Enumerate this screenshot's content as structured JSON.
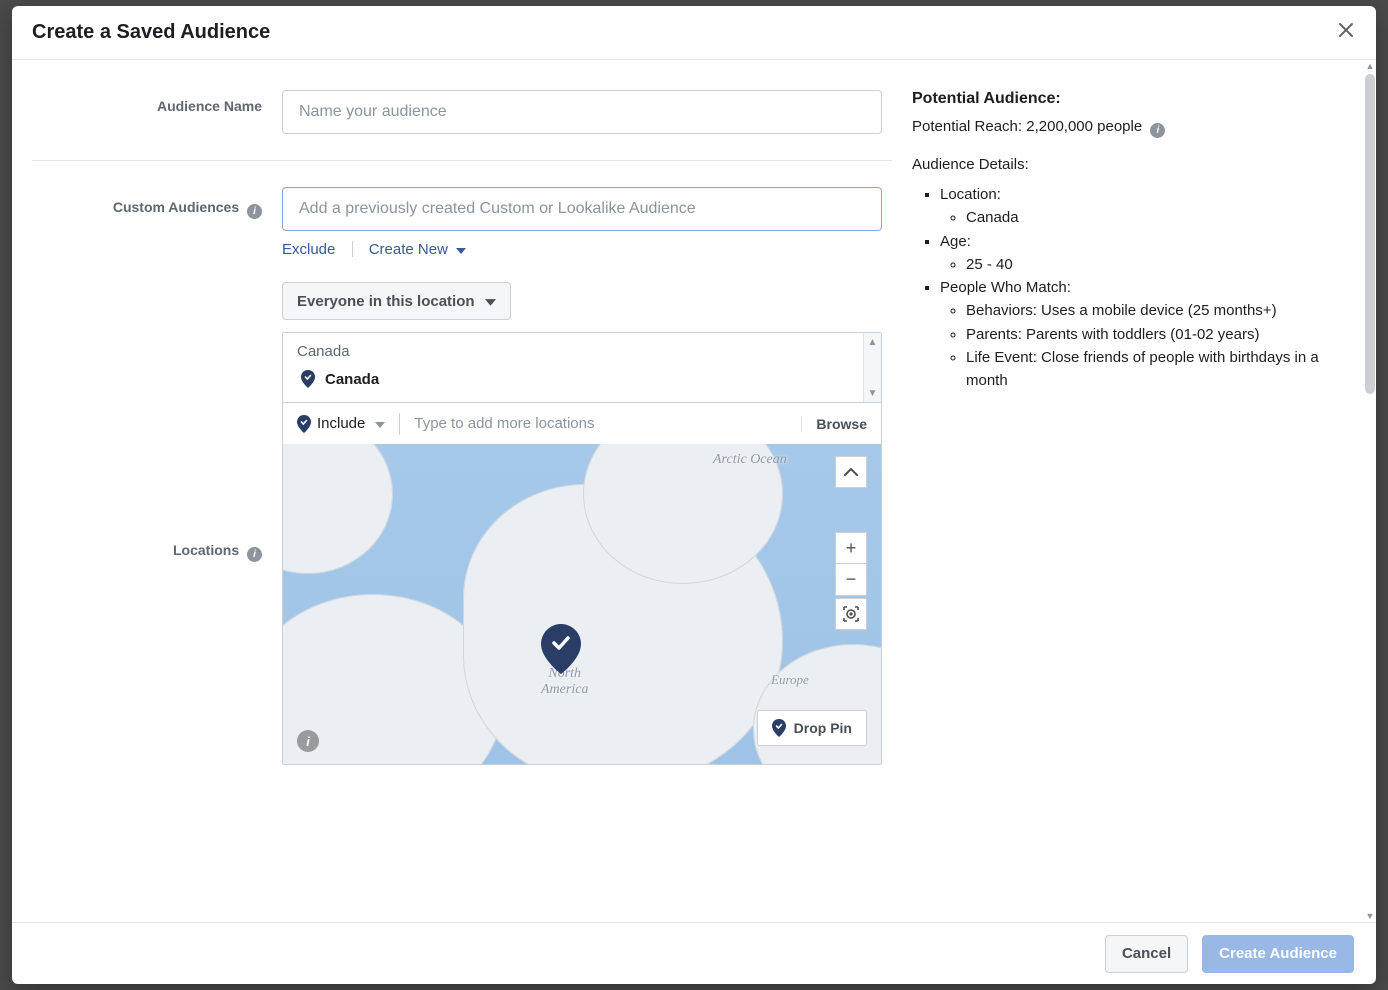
{
  "modal": {
    "title": "Create a Saved Audience"
  },
  "audienceName": {
    "label": "Audience Name",
    "placeholder": "Name your audience"
  },
  "customAudiences": {
    "label": "Custom Audiences",
    "placeholder": "Add a previously created Custom or Lookalike Audience",
    "excludeLink": "Exclude",
    "createNewLink": "Create New"
  },
  "locations": {
    "label": "Locations",
    "scopeDropdown": "Everyone in this location",
    "searchHeader": "Canada",
    "selectedCountry": "Canada",
    "includeDropdown": "Include",
    "addMorePlaceholder": "Type to add more locations",
    "browse": "Browse",
    "dropPin": "Drop Pin",
    "mapLabels": {
      "arcticOcean": "Arctic Ocean",
      "northAmerica": "North\nAmerica",
      "europe": "Europe"
    }
  },
  "summary": {
    "potentialAudienceTitle": "Potential Audience:",
    "reachLabel": "Potential Reach:",
    "reachValue": "2,200,000 people",
    "detailsTitle": "Audience Details:",
    "location": {
      "label": "Location:",
      "value": "Canada"
    },
    "age": {
      "label": "Age:",
      "value": "25 - 40"
    },
    "match": {
      "label": "People Who Match:",
      "behaviors": "Behaviors: Uses a mobile device (25 months+)",
      "parents": "Parents: Parents with toddlers (01-02 years)",
      "lifeEvent": "Life Event: Close friends of people with birthdays in a month"
    }
  },
  "footer": {
    "cancel": "Cancel",
    "create": "Create Audience"
  }
}
